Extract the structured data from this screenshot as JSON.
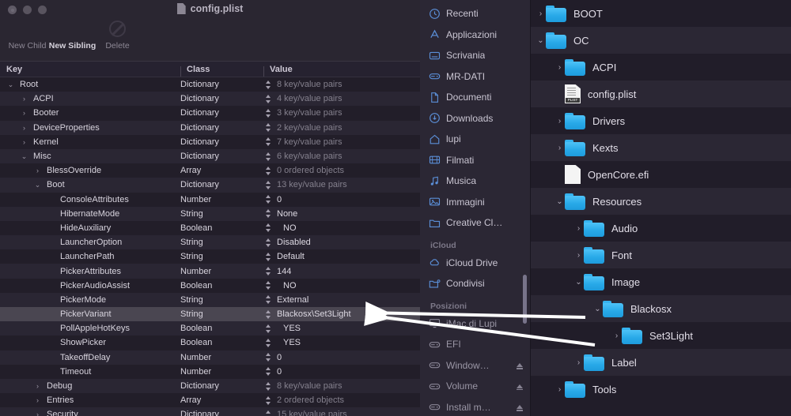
{
  "plist_window": {
    "title": "config.plist",
    "title_icon": "document-icon",
    "toolbar": [
      {
        "label": "New Child",
        "icon": "new-child-icon",
        "enabled": false
      },
      {
        "label": "New Sibling",
        "icon": "new-sibling-icon",
        "enabled": true
      },
      {
        "label": "Delete",
        "icon": "delete-icon",
        "enabled": false
      }
    ],
    "columns": {
      "key": "Key",
      "class": "Class",
      "value": "Value"
    },
    "rows": [
      {
        "key": "Root",
        "indent": 0,
        "disc": "down",
        "class": "Dictionary",
        "value": "8 key/value pairs",
        "dim": true,
        "stepper": true
      },
      {
        "key": "ACPI",
        "indent": 1,
        "disc": "right",
        "class": "Dictionary",
        "value": "4 key/value pairs",
        "dim": true,
        "stepper": true
      },
      {
        "key": "Booter",
        "indent": 1,
        "disc": "right",
        "class": "Dictionary",
        "value": "3 key/value pairs",
        "dim": true,
        "stepper": true
      },
      {
        "key": "DeviceProperties",
        "indent": 1,
        "disc": "right",
        "class": "Dictionary",
        "value": "2 key/value pairs",
        "dim": true,
        "stepper": true
      },
      {
        "key": "Kernel",
        "indent": 1,
        "disc": "right",
        "class": "Dictionary",
        "value": "7 key/value pairs",
        "dim": true,
        "stepper": true
      },
      {
        "key": "Misc",
        "indent": 1,
        "disc": "down",
        "class": "Dictionary",
        "value": "6 key/value pairs",
        "dim": true,
        "stepper": true
      },
      {
        "key": "BlessOverride",
        "indent": 2,
        "disc": "right",
        "class": "Array",
        "value": "0 ordered objects",
        "dim": true,
        "stepper": true
      },
      {
        "key": "Boot",
        "indent": 2,
        "disc": "down",
        "class": "Dictionary",
        "value": "13 key/value pairs",
        "dim": true,
        "stepper": true
      },
      {
        "key": "ConsoleAttributes",
        "indent": 3,
        "disc": "none",
        "class": "Number",
        "value": "0",
        "dim": false,
        "stepper": true
      },
      {
        "key": "HibernateMode",
        "indent": 3,
        "disc": "none",
        "class": "String",
        "value": "None",
        "dim": false,
        "stepper": true
      },
      {
        "key": "HideAuxiliary",
        "indent": 3,
        "disc": "none",
        "class": "Boolean",
        "value": "NO",
        "dim": false,
        "stepper": true,
        "bool": true
      },
      {
        "key": "LauncherOption",
        "indent": 3,
        "disc": "none",
        "class": "String",
        "value": "Disabled",
        "dim": false,
        "stepper": true
      },
      {
        "key": "LauncherPath",
        "indent": 3,
        "disc": "none",
        "class": "String",
        "value": "Default",
        "dim": false,
        "stepper": true
      },
      {
        "key": "PickerAttributes",
        "indent": 3,
        "disc": "none",
        "class": "Number",
        "value": "144",
        "dim": false,
        "stepper": true
      },
      {
        "key": "PickerAudioAssist",
        "indent": 3,
        "disc": "none",
        "class": "Boolean",
        "value": "NO",
        "dim": false,
        "stepper": true,
        "bool": true
      },
      {
        "key": "PickerMode",
        "indent": 3,
        "disc": "none",
        "class": "String",
        "value": "External",
        "dim": false,
        "stepper": true
      },
      {
        "key": "PickerVariant",
        "indent": 3,
        "disc": "none",
        "class": "String",
        "value": "Blackosx\\Set3Light",
        "dim": false,
        "stepper": true,
        "selected": true
      },
      {
        "key": "PollAppleHotKeys",
        "indent": 3,
        "disc": "none",
        "class": "Boolean",
        "value": "YES",
        "dim": false,
        "stepper": true,
        "bool": true
      },
      {
        "key": "ShowPicker",
        "indent": 3,
        "disc": "none",
        "class": "Boolean",
        "value": "YES",
        "dim": false,
        "stepper": true,
        "bool": true
      },
      {
        "key": "TakeoffDelay",
        "indent": 3,
        "disc": "none",
        "class": "Number",
        "value": "0",
        "dim": false,
        "stepper": true
      },
      {
        "key": "Timeout",
        "indent": 3,
        "disc": "none",
        "class": "Number",
        "value": "0",
        "dim": false,
        "stepper": true
      },
      {
        "key": "Debug",
        "indent": 2,
        "disc": "right",
        "class": "Dictionary",
        "value": "8 key/value pairs",
        "dim": true,
        "stepper": true
      },
      {
        "key": "Entries",
        "indent": 2,
        "disc": "right",
        "class": "Array",
        "value": "2 ordered objects",
        "dim": true,
        "stepper": true
      },
      {
        "key": "Security",
        "indent": 2,
        "disc": "right",
        "class": "Dictionary",
        "value": "15 key/value pairs",
        "dim": true,
        "stepper": true
      }
    ]
  },
  "finder_sidebar": {
    "items": [
      {
        "label": "Recenti",
        "icon": "clock-icon",
        "type": "item"
      },
      {
        "label": "Applicazioni",
        "icon": "appstore-icon",
        "type": "item"
      },
      {
        "label": "Scrivania",
        "icon": "desktop-icon",
        "type": "item"
      },
      {
        "label": "MR-DATI",
        "icon": "drive-icon",
        "type": "item"
      },
      {
        "label": "Documenti",
        "icon": "document-icon",
        "type": "item"
      },
      {
        "label": "Downloads",
        "icon": "download-icon",
        "type": "item"
      },
      {
        "label": "lupi",
        "icon": "home-icon",
        "type": "item"
      },
      {
        "label": "Filmati",
        "icon": "movie-icon",
        "type": "item"
      },
      {
        "label": "Musica",
        "icon": "music-icon",
        "type": "item"
      },
      {
        "label": "Immagini",
        "icon": "photo-icon",
        "type": "item"
      },
      {
        "label": "Creative Cl…",
        "icon": "folder-icon",
        "type": "item"
      },
      {
        "label": "iCloud",
        "icon": "",
        "type": "header"
      },
      {
        "label": "iCloud Drive",
        "icon": "cloud-icon",
        "type": "item"
      },
      {
        "label": "Condivisi",
        "icon": "shared-folder-icon",
        "type": "item"
      },
      {
        "label": "Posizioni",
        "icon": "",
        "type": "header"
      },
      {
        "label": "iMac di Lupi",
        "icon": "imac-icon",
        "type": "item",
        "dim": true
      },
      {
        "label": "EFI",
        "icon": "drive-icon",
        "type": "item",
        "dim": true
      },
      {
        "label": "Window…",
        "icon": "drive-icon",
        "type": "item",
        "dim": true,
        "eject": true
      },
      {
        "label": "Volume",
        "icon": "drive-icon",
        "type": "item",
        "dim": true,
        "eject": true
      },
      {
        "label": "Install m…",
        "icon": "drive-icon",
        "type": "item",
        "dim": true,
        "eject": true
      }
    ]
  },
  "file_tree": {
    "rows": [
      {
        "name": "BOOT",
        "indent": 0,
        "disc": "right",
        "icon": "folder-icon",
        "alt": false
      },
      {
        "name": "OC",
        "indent": 0,
        "disc": "down",
        "icon": "folder-icon",
        "alt": true
      },
      {
        "name": "ACPI",
        "indent": 1,
        "disc": "right",
        "icon": "folder-icon",
        "alt": false
      },
      {
        "name": "config.plist",
        "indent": 1,
        "disc": "none",
        "icon": "plist-file-icon",
        "alt": true
      },
      {
        "name": "Drivers",
        "indent": 1,
        "disc": "right",
        "icon": "folder-icon",
        "alt": false
      },
      {
        "name": "Kexts",
        "indent": 1,
        "disc": "right",
        "icon": "folder-icon",
        "alt": true
      },
      {
        "name": "OpenCore.efi",
        "indent": 1,
        "disc": "none",
        "icon": "efi-file-icon",
        "alt": false
      },
      {
        "name": "Resources",
        "indent": 1,
        "disc": "down",
        "icon": "folder-icon",
        "alt": true
      },
      {
        "name": "Audio",
        "indent": 2,
        "disc": "right",
        "icon": "folder-icon",
        "alt": false
      },
      {
        "name": "Font",
        "indent": 2,
        "disc": "right",
        "icon": "folder-icon",
        "alt": true
      },
      {
        "name": "Image",
        "indent": 2,
        "disc": "down",
        "icon": "folder-icon",
        "alt": false
      },
      {
        "name": "Blackosx",
        "indent": 3,
        "disc": "down",
        "icon": "folder-icon",
        "alt": true
      },
      {
        "name": "Set3Light",
        "indent": 4,
        "disc": "right",
        "icon": "folder-icon",
        "alt": false
      },
      {
        "name": "Label",
        "indent": 2,
        "disc": "right",
        "icon": "folder-icon",
        "alt": true
      },
      {
        "name": "Tools",
        "indent": 1,
        "disc": "right",
        "icon": "folder-icon",
        "alt": false
      }
    ]
  },
  "annotations": {
    "arrow_color": "#ffffff",
    "arrow_count": 2
  }
}
